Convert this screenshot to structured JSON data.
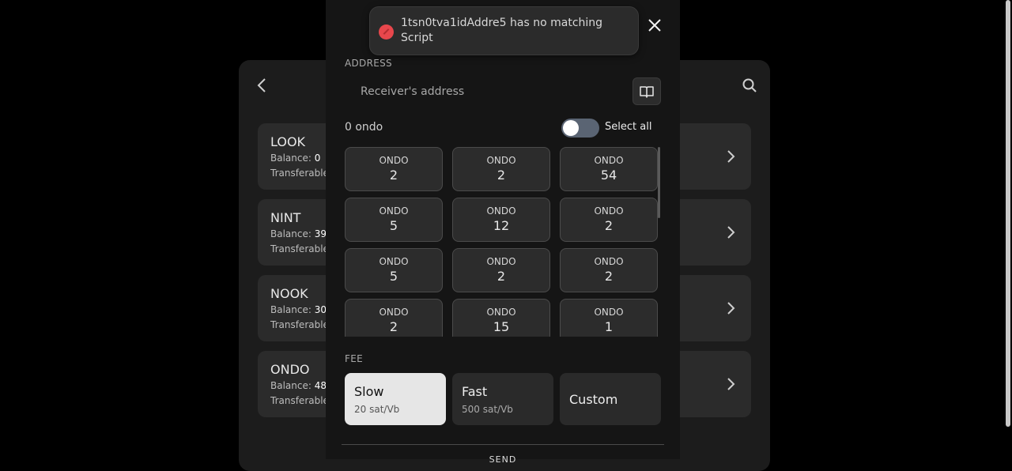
{
  "background": {
    "tokens": [
      {
        "name": "LOOK",
        "balance_label": "Balance:",
        "balance": "0",
        "transferable_label": "Transferable"
      },
      {
        "name": "NINT",
        "balance_label": "Balance:",
        "balance": "39",
        "transferable_label": "Transferable"
      },
      {
        "name": "NOOK",
        "balance_label": "Balance:",
        "balance": "30",
        "transferable_label": "Transferable"
      },
      {
        "name": "ONDO",
        "balance_label": "Balance:",
        "balance": "48",
        "transferable_label": "Transferable"
      }
    ]
  },
  "toast": {
    "message": "1tsn0tva1idAddre5 has no matching Script",
    "status_color": "#e8474c"
  },
  "modal": {
    "address_label": "ADDRESS",
    "address_placeholder": "Receiver's address",
    "selected_count": "0 ondo",
    "select_all_label": "Select all",
    "select_all_on": false,
    "inscriptions": [
      {
        "ticker": "ONDO",
        "amount": "2"
      },
      {
        "ticker": "ONDO",
        "amount": "2"
      },
      {
        "ticker": "ONDO",
        "amount": "54"
      },
      {
        "ticker": "ONDO",
        "amount": "5"
      },
      {
        "ticker": "ONDO",
        "amount": "12"
      },
      {
        "ticker": "ONDO",
        "amount": "2"
      },
      {
        "ticker": "ONDO",
        "amount": "5"
      },
      {
        "ticker": "ONDO",
        "amount": "2"
      },
      {
        "ticker": "ONDO",
        "amount": "2"
      },
      {
        "ticker": "ONDO",
        "amount": "2"
      },
      {
        "ticker": "ONDO",
        "amount": "15"
      },
      {
        "ticker": "ONDO",
        "amount": "1"
      }
    ],
    "fee_label": "FEE",
    "fees": [
      {
        "name": "Slow",
        "rate": "20 sat/Vb",
        "selected": true
      },
      {
        "name": "Fast",
        "rate": "500 sat/Vb",
        "selected": false
      },
      {
        "name": "Custom",
        "rate": "",
        "selected": false
      }
    ],
    "send_label": "SEND"
  },
  "icons": {
    "close": "close-icon",
    "address_book": "book-icon",
    "back": "chevron-left-icon",
    "search": "search-icon",
    "chevron": "chevron-right-icon"
  }
}
